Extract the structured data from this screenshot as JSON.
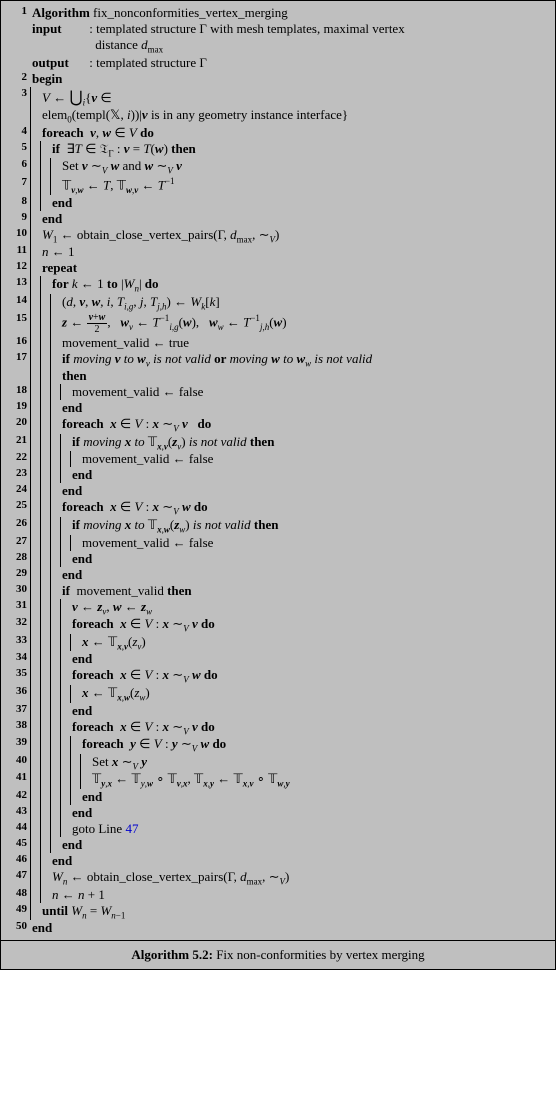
{
  "caption_label": "Algorithm 5.2:",
  "caption_text": " Fix non-conformities by vertex merging",
  "lines": [
    {
      "n": "1",
      "bars": 0,
      "html": "<span class='kw'>Algorithm</span> fix_nonconformities_vertex_merging"
    },
    {
      "n": "",
      "bars": 0,
      "html": "<span class='kw' style='display:inline-block;width:54px'>input</span> : templated structure Γ with mesh templates, maximal vertex"
    },
    {
      "n": "",
      "bars": 0,
      "html": "<span style='display:inline-block;width:60px'></span> distance <span class='math'>d</span><span class='sub'>max</span>"
    },
    {
      "n": "",
      "bars": 0,
      "html": "<span class='kw' style='display:inline-block;width:54px'>output</span> : templated structure Γ"
    },
    {
      "n": "2",
      "bars": 0,
      "html": "<span class='kw'>begin</span>"
    },
    {
      "n": "3",
      "bars": 1,
      "html": "<span class='math'>V</span> ← <span class='bigcup'>⋃</span><span class='sub'><span class='math'>i</span></span>{<span class='bi'>v</span> ∈"
    },
    {
      "n": "",
      "bars": 1,
      "html": "elem<span class='sub'>0</span>(templ(𝕏, <span class='math'>i</span>))|<span class='bi'>v</span> is in any geometry instance interface}"
    },
    {
      "n": "4",
      "bars": 1,
      "html": "<span class='kw'>foreach</span>&nbsp;&nbsp;<span class='bi'>v</span>, <span class='bi'>w</span> ∈ <span class='math'>V</span> <span class='kw'>do</span>"
    },
    {
      "n": "5",
      "bars": 2,
      "html": "<span class='kw'>if</span>&nbsp;&nbsp;∃<span class='math'>T</span> ∈ 𝔗<span class='sub'>Γ</span> : <span class='bi'>v</span> = <span class='math'>T</span>(<span class='bi'>w</span>) <span class='kw'>then</span>"
    },
    {
      "n": "6",
      "bars": 3,
      "html": "Set <span class='bi'>v</span> ∼<span class='sub'><span class='math'>V</span></span> <span class='bi'>w</span> and <span class='bi'>w</span> ∼<span class='sub'><span class='math'>V</span></span> <span class='bi'>v</span>"
    },
    {
      "n": "7",
      "bars": 3,
      "html": "𝕋<span class='sub'><span class='bi'>v</span>,<span class='bi'>w</span></span> ← <span class='math'>T</span>, 𝕋<span class='sub'><span class='bi'>w</span>,<span class='bi'>v</span></span> ← <span class='math'>T</span><span class='sup'>−1</span>"
    },
    {
      "n": "8",
      "bars": 2,
      "html": "<span class='kw'>end</span>"
    },
    {
      "n": "9",
      "bars": 1,
      "html": "<span class='kw'>end</span>"
    },
    {
      "n": "10",
      "bars": 1,
      "html": "<span class='math'>W</span><span class='sub'>1</span> ← obtain_close_vertex_pairs(Γ, <span class='math'>d</span><span class='sub'>max</span>, ∼<span class='sub'><span class='math'>V</span></span>)"
    },
    {
      "n": "11",
      "bars": 1,
      "html": "<span class='math'>n</span> ← 1"
    },
    {
      "n": "12",
      "bars": 1,
      "html": "<span class='kw'>repeat</span>"
    },
    {
      "n": "13",
      "bars": 2,
      "html": "<span class='kw'>for</span> <span class='math'>k</span> ← 1 <span class='kw'>to</span> |<span class='math'>W<span class='sub'>n</span></span>| <span class='kw'>do</span>"
    },
    {
      "n": "14",
      "bars": 3,
      "html": "(<span class='math'>d</span>, <span class='bi'>v</span>, <span class='bi'>w</span>, <span class='math'>i</span>, <span class='math'>T<span class='sub'>i,g</span></span>, <span class='math'>j</span>, <span class='math'>T<span class='sub'>j,h</span></span>) ← <span class='math'>W<span class='sub'>k</span></span>[<span class='math'>k</span>]"
    },
    {
      "n": "15",
      "bars": 3,
      "html": "<span class='bi'>z</span> ← <span style='display:inline-block;text-align:center;vertical-align:middle'><span style='display:block;border-bottom:1px solid #000;font-size:10px;padding:0 2px'><span class='bi'>v</span>+<span class='bi'>w</span></span><span style='display:block;font-size:10px'>2</span></span>,&nbsp;&nbsp;&nbsp;<span class='bi'>w</span><span class='sub'><span class='math'>v</span></span> ← <span class='math'>T</span><span class='sup'>−1</span><span class='sub'><span class='math'>i,g</span></span>(<span class='bi'>w</span>),&nbsp;&nbsp;&nbsp;<span class='bi'>w</span><span class='sub'><span class='math'>w</span></span> ← <span class='math'>T</span><span class='sup'>−1</span><span class='sub'><span class='math'>j,h</span></span>(<span class='bi'>w</span>)"
    },
    {
      "n": "16",
      "bars": 3,
      "html": "movement_valid ← true"
    },
    {
      "n": "17",
      "bars": 3,
      "html": "<span class='kw'>if</span> <span class='it'>moving <span class='bi'>v</span> to <span class='bi'>w</span><span class='sub'>v</span> is not valid</span> <span class='kw'>or</span> <span class='it'>moving <span class='bi'>w</span> to <span class='bi'>w</span><span class='sub'>w</span> is not valid</span>"
    },
    {
      "n": "",
      "bars": 3,
      "html": "<span class='kw'>then</span>"
    },
    {
      "n": "18",
      "bars": 4,
      "html": "movement_valid ← false"
    },
    {
      "n": "19",
      "bars": 3,
      "html": "<span class='kw'>end</span>"
    },
    {
      "n": "20",
      "bars": 3,
      "html": "<span class='kw'>foreach</span>&nbsp;&nbsp;<span class='bi'>x</span> ∈ <span class='math'>V</span> : <span class='bi'>x</span> ∼<span class='sub'><span class='math'>V</span></span> <span class='bi'>v</span>&nbsp;&nbsp;&nbsp;<span class='kw'>do</span>"
    },
    {
      "n": "21",
      "bars": 4,
      "html": "<span class='kw'>if</span> <span class='it'>moving <span class='bi'>x</span> to</span> 𝕋<span class='sub'><span class='bi'>x</span>,<span class='bi'>v</span></span>(<span class='bi'>z</span><span class='sub'><span class='math'>v</span></span>) <span class='it'>is not valid</span> <span class='kw'>then</span>"
    },
    {
      "n": "22",
      "bars": 5,
      "html": "movement_valid ← false"
    },
    {
      "n": "23",
      "bars": 4,
      "html": "<span class='kw'>end</span>"
    },
    {
      "n": "24",
      "bars": 3,
      "html": "<span class='kw'>end</span>"
    },
    {
      "n": "25",
      "bars": 3,
      "html": "<span class='kw'>foreach</span>&nbsp;&nbsp;<span class='bi'>x</span> ∈ <span class='math'>V</span> : <span class='bi'>x</span> ∼<span class='sub'><span class='math'>V</span></span> <span class='bi'>w</span> <span class='kw'>do</span>"
    },
    {
      "n": "26",
      "bars": 4,
      "html": "<span class='kw'>if</span> <span class='it'>moving <span class='bi'>x</span> to</span> 𝕋<span class='sub'><span class='bi'>x</span>,<span class='bi'>w</span></span>(<span class='bi'>z</span><span class='sub'><span class='math'>w</span></span>) <span class='it'>is not valid</span> <span class='kw'>then</span>"
    },
    {
      "n": "27",
      "bars": 5,
      "html": "movement_valid ← false"
    },
    {
      "n": "28",
      "bars": 4,
      "html": "<span class='kw'>end</span>"
    },
    {
      "n": "29",
      "bars": 3,
      "html": "<span class='kw'>end</span>"
    },
    {
      "n": "30",
      "bars": 3,
      "html": "<span class='kw'>if</span>&nbsp;&nbsp;movement_valid <span class='kw'>then</span>"
    },
    {
      "n": "31",
      "bars": 4,
      "html": "<span class='bi'>v</span> ← <span class='bi'>z</span><span class='sub'><span class='math'>v</span></span>, <span class='bi'>w</span> ← <span class='bi'>z</span><span class='sub'><span class='math'>w</span></span>"
    },
    {
      "n": "32",
      "bars": 4,
      "html": "<span class='kw'>foreach</span>&nbsp;&nbsp;<span class='bi'>x</span> ∈ <span class='math'>V</span> : <span class='bi'>x</span> ∼<span class='sub'><span class='math'>V</span></span> <span class='bi'>v</span> <span class='kw'>do</span>"
    },
    {
      "n": "33",
      "bars": 5,
      "html": "<span class='bi'>x</span> ← 𝕋<span class='sub'><span class='bi'>x</span>,<span class='bi'>v</span></span>(<span class='math'>z<span class='sub'>v</span></span>)"
    },
    {
      "n": "34",
      "bars": 4,
      "html": "<span class='kw'>end</span>"
    },
    {
      "n": "35",
      "bars": 4,
      "html": "<span class='kw'>foreach</span>&nbsp;&nbsp;<span class='bi'>x</span> ∈ <span class='math'>V</span> : <span class='bi'>x</span> ∼<span class='sub'><span class='math'>V</span></span> <span class='bi'>w</span> <span class='kw'>do</span>"
    },
    {
      "n": "36",
      "bars": 5,
      "html": "<span class='bi'>x</span> ← 𝕋<span class='sub'><span class='bi'>x</span>,<span class='bi'>w</span></span>(<span class='math'>z<span class='sub'>w</span></span>)"
    },
    {
      "n": "37",
      "bars": 4,
      "html": "<span class='kw'>end</span>"
    },
    {
      "n": "38",
      "bars": 4,
      "html": "<span class='kw'>foreach</span>&nbsp;&nbsp;<span class='bi'>x</span> ∈ <span class='math'>V</span> : <span class='bi'>x</span> ∼<span class='sub'><span class='math'>V</span></span> <span class='bi'>v</span> <span class='kw'>do</span>"
    },
    {
      "n": "39",
      "bars": 5,
      "html": "<span class='kw'>foreach</span>&nbsp;&nbsp;<span class='bi'>y</span> ∈ <span class='math'>V</span> : <span class='bi'>y</span> ∼<span class='sub'><span class='math'>V</span></span> <span class='bi'>w</span> <span class='kw'>do</span>"
    },
    {
      "n": "40",
      "bars": 6,
      "html": "Set <span class='bi'>x</span> ∼<span class='sub'><span class='math'>V</span></span> <span class='bi'>y</span>"
    },
    {
      "n": "41",
      "bars": 6,
      "html": "𝕋<span class='sub'><span class='bi'>y</span>,<span class='bi'>x</span></span> ← 𝕋<span class='sub'><span class='math'>y</span>,<span class='bi'>w</span></span> ∘ 𝕋<span class='sub'><span class='bi'>v</span>,<span class='bi'>x</span></span>, 𝕋<span class='sub'><span class='bi'>x</span>,<span class='bi'>y</span></span> ← 𝕋<span class='sub'><span class='bi'>x</span>,<span class='bi'>v</span></span> ∘ 𝕋<span class='sub'><span class='bi'>w</span>,<span class='bi'>y</span></span>"
    },
    {
      "n": "42",
      "bars": 5,
      "html": "<span class='kw'>end</span>"
    },
    {
      "n": "43",
      "bars": 4,
      "html": "<span class='kw'>end</span>"
    },
    {
      "n": "44",
      "bars": 4,
      "html": "goto Line <span class='link'>47</span>"
    },
    {
      "n": "45",
      "bars": 3,
      "html": "<span class='kw'>end</span>"
    },
    {
      "n": "46",
      "bars": 2,
      "html": "<span class='kw'>end</span>"
    },
    {
      "n": "47",
      "bars": 2,
      "html": "<span class='math'>W<span class='sub'>n</span></span> ← obtain_close_vertex_pairs(Γ, <span class='math'>d</span><span class='sub'>max</span>, ∼<span class='sub'><span class='math'>V</span></span>)"
    },
    {
      "n": "48",
      "bars": 2,
      "html": "<span class='math'>n</span> ← <span class='math'>n</span> + 1"
    },
    {
      "n": "49",
      "bars": 1,
      "html": "<span class='kw'>until</span> <span class='math'>W<span class='sub'>n</span></span> = <span class='math'>W</span><span class='sub'><span class='math'>n</span>−1</span>"
    },
    {
      "n": "50",
      "bars": 0,
      "html": "<span class='kw'>end</span>"
    }
  ]
}
